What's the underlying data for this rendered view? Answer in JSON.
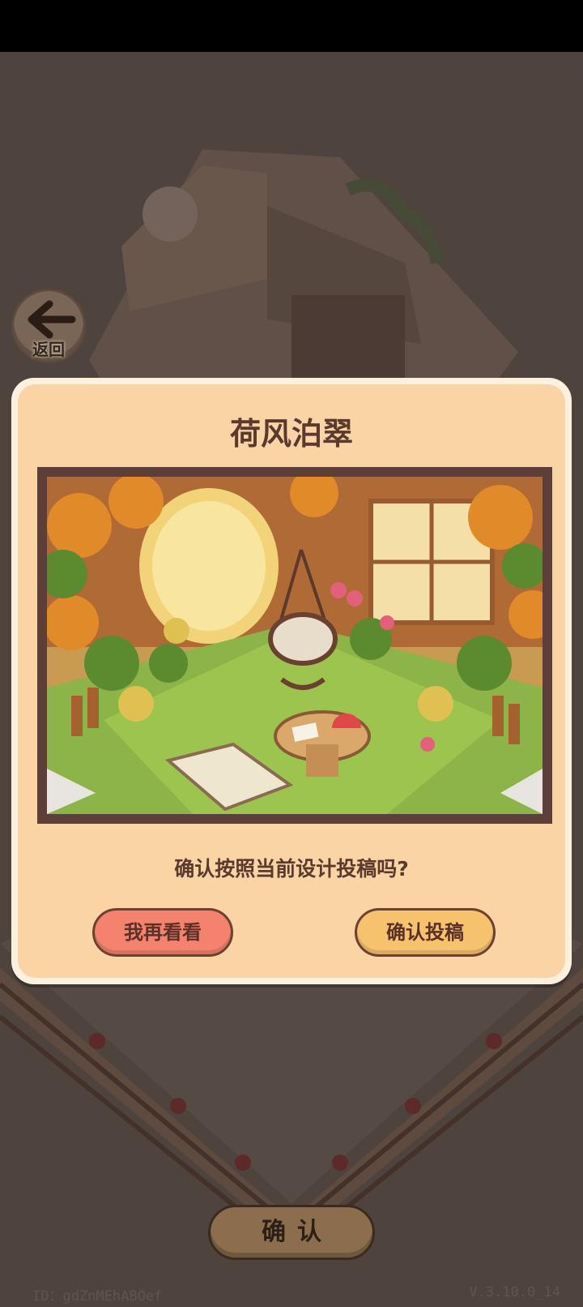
{
  "back_button": {
    "label": "返回"
  },
  "dialog": {
    "title": "荷风泊翠",
    "question": "确认按照当前设计投稿吗?",
    "cancel_label": "我再看看",
    "submit_label": "确认投稿"
  },
  "bottom_confirm_label": "确认",
  "footer": {
    "id_text": "ID：gdZnMEhABOef",
    "version_text": "V.3.10.0_14"
  },
  "colors": {
    "dialog_bg": "#fbd4a6",
    "cancel_button": "#f3826e",
    "submit_button": "#f7c26e",
    "title_text": "#5a3a2e"
  }
}
